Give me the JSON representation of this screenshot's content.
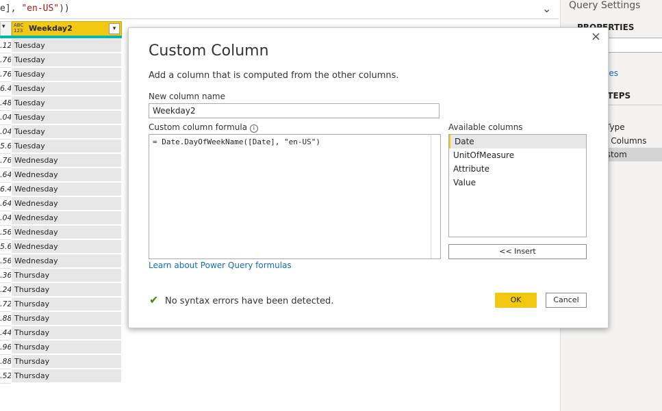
{
  "formula_bar": {
    "visible_text_pre": "e], ",
    "visible_text_str": "\"en-US\"",
    "visible_text_post": "))"
  },
  "grid": {
    "column_header": "Weekday2",
    "type_icon_top": "ABC",
    "type_icon_bottom": "123",
    "rows": [
      [
        ".12",
        "Tuesday"
      ],
      [
        ".76",
        "Tuesday"
      ],
      [
        ".76",
        "Tuesday"
      ],
      [
        "6.4",
        "Tuesday"
      ],
      [
        ".48",
        "Tuesday"
      ],
      [
        ".04",
        "Tuesday"
      ],
      [
        ".04",
        "Tuesday"
      ],
      [
        "5.6",
        "Tuesday"
      ],
      [
        ".76",
        "Wednesday"
      ],
      [
        ".64",
        "Wednesday"
      ],
      [
        "6.4",
        "Wednesday"
      ],
      [
        ".64",
        "Wednesday"
      ],
      [
        ".04",
        "Wednesday"
      ],
      [
        ".56",
        "Wednesday"
      ],
      [
        "5.6",
        "Wednesday"
      ],
      [
        ".56",
        "Wednesday"
      ],
      [
        ".36",
        "Thursday"
      ],
      [
        ".24",
        "Thursday"
      ],
      [
        ".72",
        "Thursday"
      ],
      [
        ".88",
        "Thursday"
      ],
      [
        ".44",
        "Thursday"
      ],
      [
        ".96",
        "Thursday"
      ],
      [
        ".88",
        "Thursday"
      ],
      [
        ".52",
        "Thursday"
      ]
    ]
  },
  "query_settings": {
    "title": "Query Settings",
    "properties": "PROPERTIES",
    "all_properties": "erties",
    "applied_steps": ") STEPS",
    "steps": [
      "rce",
      "nged Type",
      "ivoted Columns",
      "ed Custom"
    ]
  },
  "dialog": {
    "title": "Custom Column",
    "description": "Add a column that is computed from the other columns.",
    "name_label": "New column name",
    "name_value": "Weekday2",
    "formula_label": "Custom column formula",
    "formula_value": "= Date.DayOfWeekName([Date], \"en-US\")",
    "available_label": "Available columns",
    "available_columns": [
      "Date",
      "UnitOfMeasure",
      "Attribute",
      "Value"
    ],
    "insert": "<< Insert",
    "learn_link": "Learn about Power Query formulas",
    "status": "No syntax errors have been detected.",
    "ok": "OK",
    "cancel": "Cancel",
    "accent": "#f2c811"
  }
}
